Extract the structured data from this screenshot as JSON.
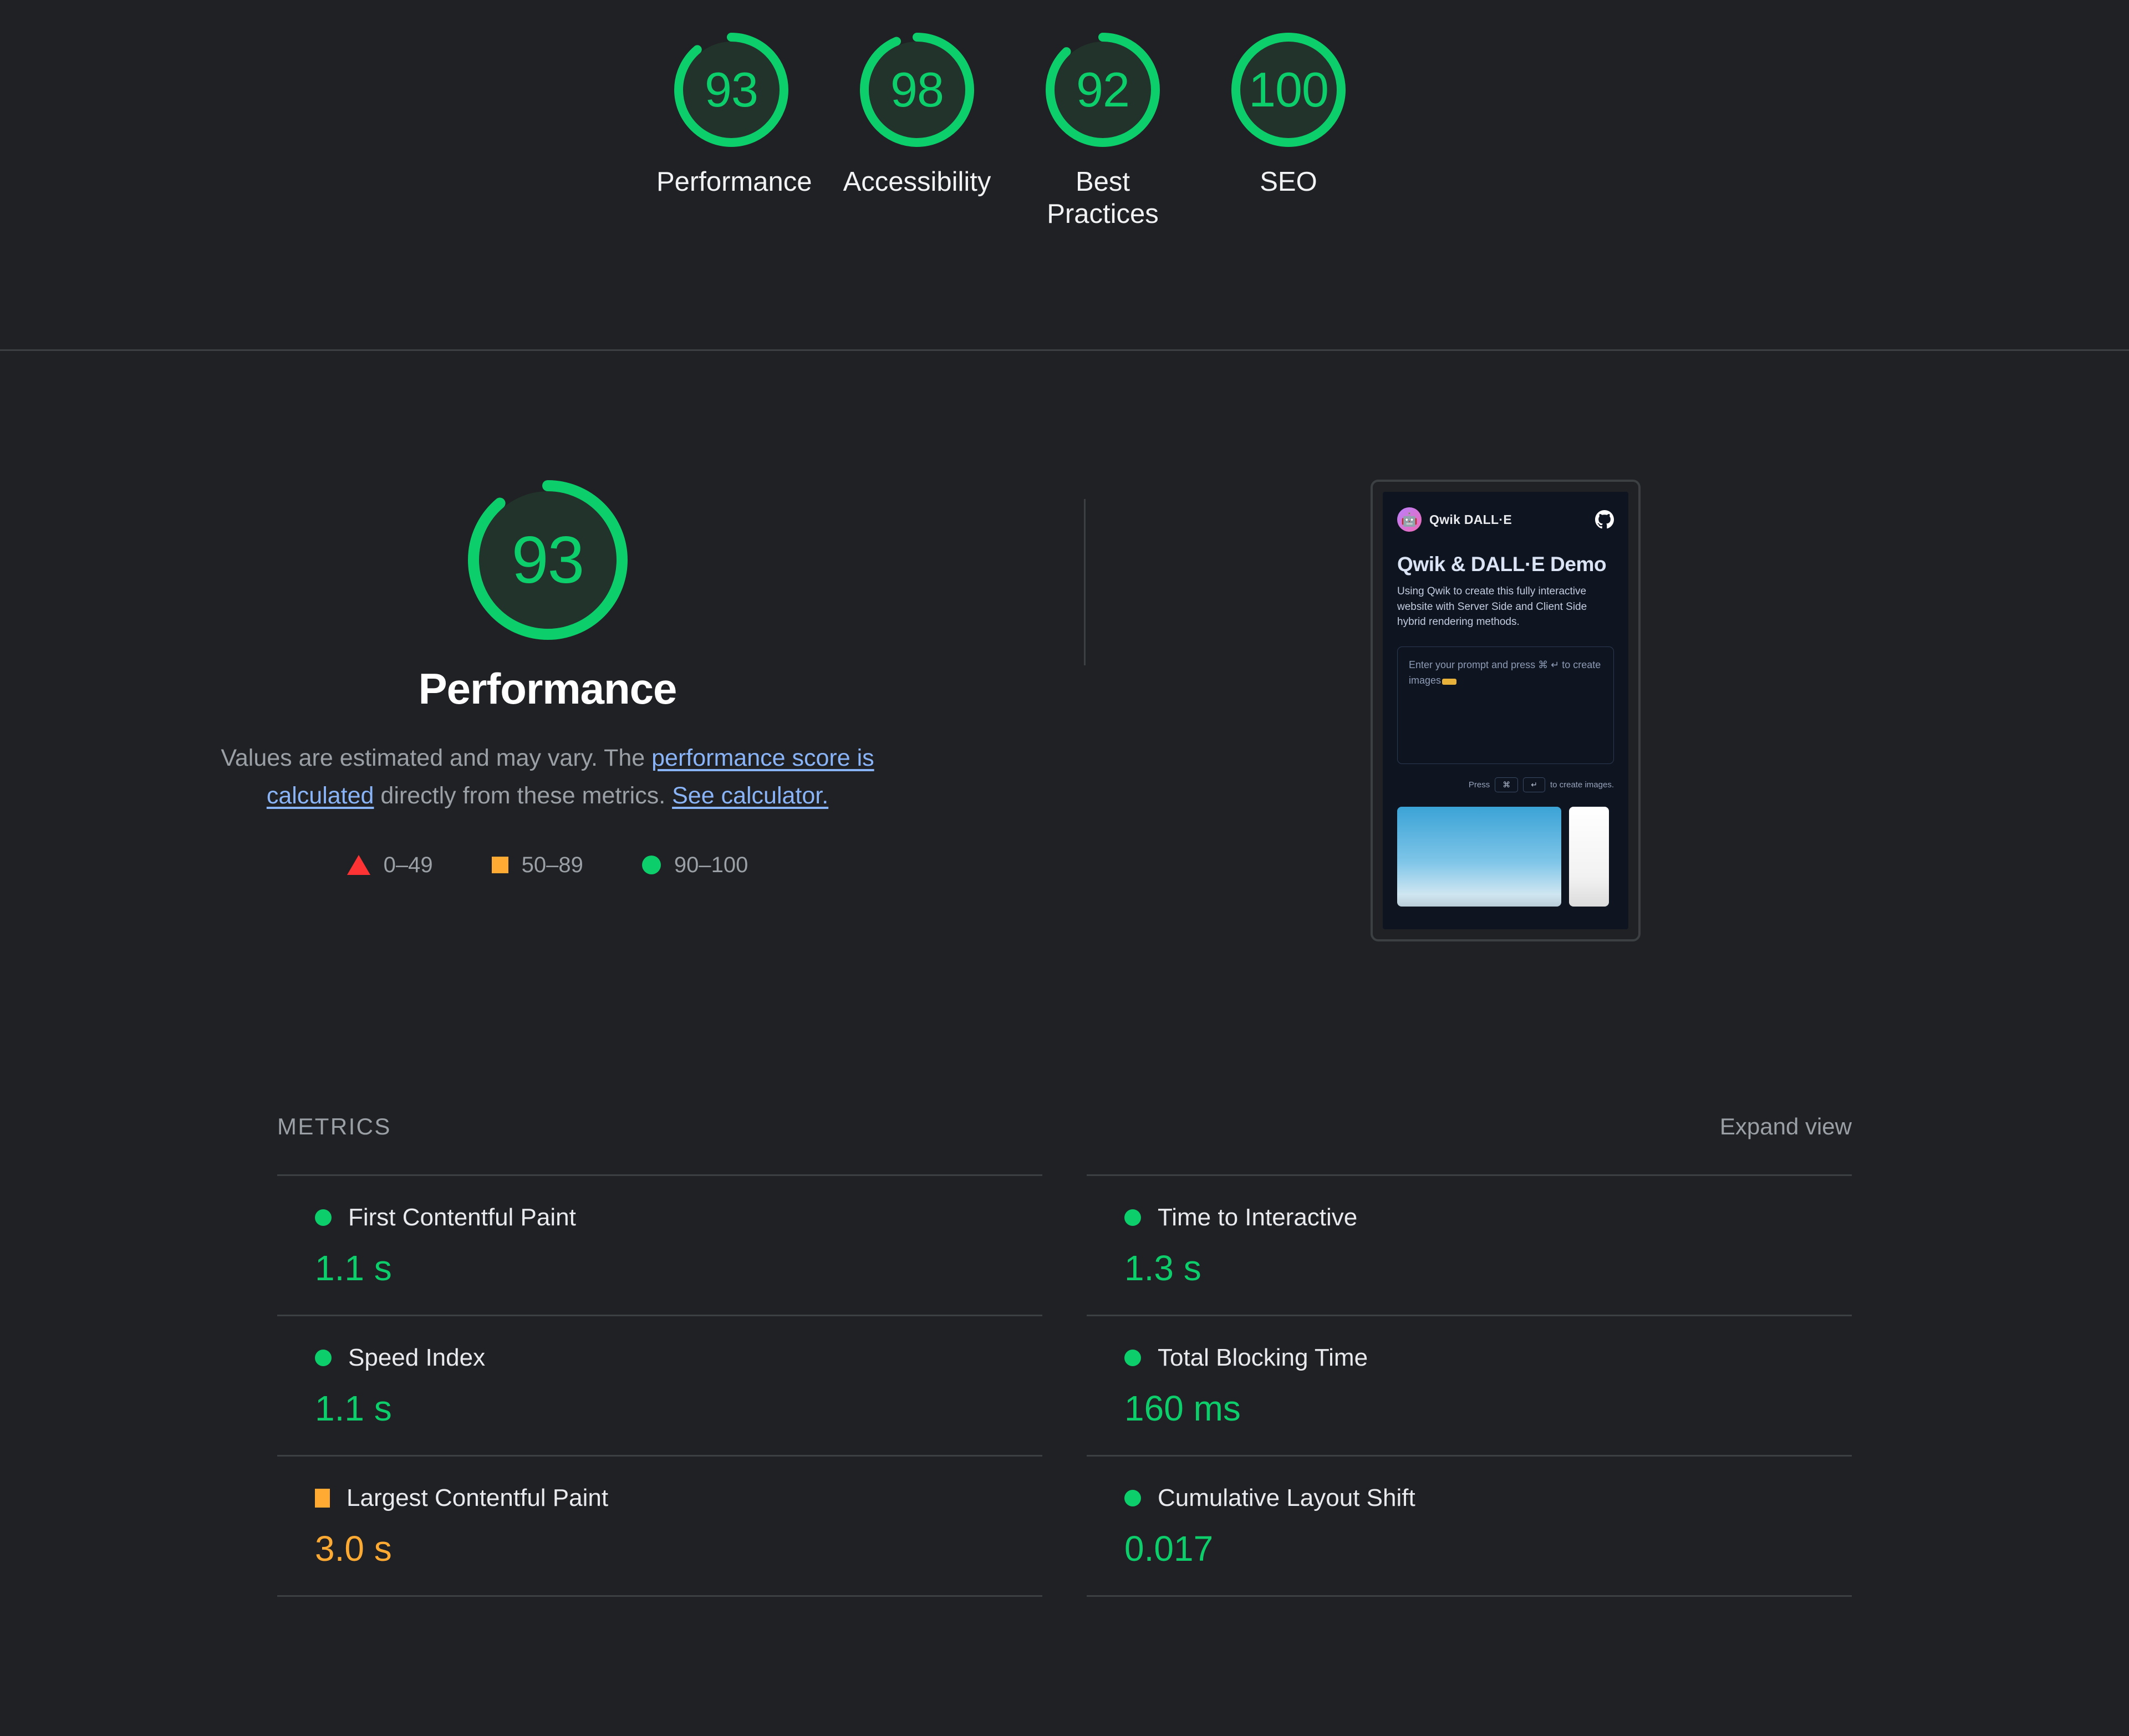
{
  "colors": {
    "background": "#202124",
    "pass": "#0cce6b",
    "average": "#ffaa33",
    "fail": "#ff3333",
    "pass_fill": "#21332a",
    "link": "#8ab4f8",
    "muted_text": "#9aa0a6",
    "primary_text": "#e8eaed",
    "divider": "#3c4043"
  },
  "score_bar": {
    "gauges": [
      {
        "score": 93,
        "label": "Performance",
        "rating": "pass"
      },
      {
        "score": 98,
        "label": "Accessibility",
        "rating": "pass"
      },
      {
        "score": 92,
        "label": "Best Practices",
        "rating": "pass"
      },
      {
        "score": 100,
        "label": "SEO",
        "rating": "pass"
      }
    ]
  },
  "category": {
    "score": 93,
    "rating": "pass",
    "title": "Performance",
    "description": {
      "part1": "Values are estimated and may vary. The ",
      "link1": "performance score is calculated",
      "part2": " directly from these metrics. ",
      "link2": "See calculator."
    },
    "legend": [
      {
        "shape": "triangle",
        "range": "0–49",
        "color": "#ff3333"
      },
      {
        "shape": "square",
        "range": "50–89",
        "color": "#ffaa33"
      },
      {
        "shape": "circle",
        "range": "90–100",
        "color": "#0cce6b"
      }
    ]
  },
  "thumbnail": {
    "brand_name": "Qwik DALL·E",
    "avatar_emoji": "🤖",
    "github_icon": "github-icon",
    "heading": "Qwik & DALL·E Demo",
    "subheading": "Using Qwik to create this fully interactive website with Server Side and Client Side hybrid rendering methods.",
    "input_placeholder": "Enter your prompt and press ⌘ ↵ to create images",
    "hint_prefix": "Press",
    "hint_key1": "⌘",
    "hint_key2": "↵",
    "hint_suffix": "to create images."
  },
  "metrics": {
    "section_title": "METRICS",
    "expand_view_label": "Expand view",
    "left_column": [
      {
        "name": "First Contentful Paint",
        "value": "1.1 s",
        "rating": "pass"
      },
      {
        "name": "Speed Index",
        "value": "1.1 s",
        "rating": "pass"
      },
      {
        "name": "Largest Contentful Paint",
        "value": "3.0 s",
        "rating": "average"
      }
    ],
    "right_column": [
      {
        "name": "Time to Interactive",
        "value": "1.3 s",
        "rating": "pass"
      },
      {
        "name": "Total Blocking Time",
        "value": "160 ms",
        "rating": "pass"
      },
      {
        "name": "Cumulative Layout Shift",
        "value": "0.017",
        "rating": "pass"
      }
    ]
  }
}
